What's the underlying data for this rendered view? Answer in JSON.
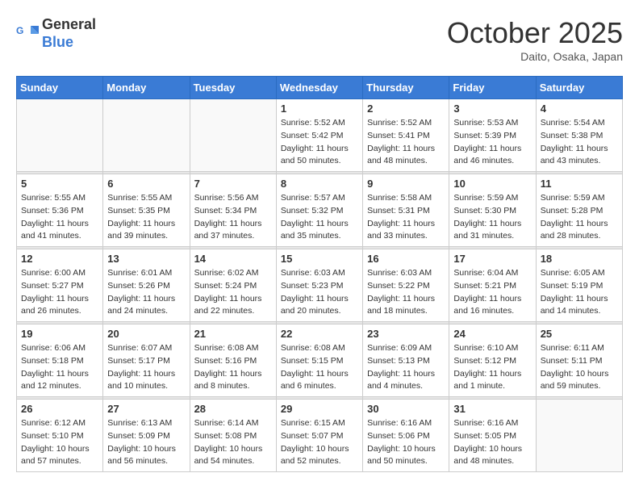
{
  "header": {
    "logo_line1": "General",
    "logo_line2": "Blue",
    "month": "October 2025",
    "location": "Daito, Osaka, Japan"
  },
  "days_of_week": [
    "Sunday",
    "Monday",
    "Tuesday",
    "Wednesday",
    "Thursday",
    "Friday",
    "Saturday"
  ],
  "weeks": [
    [
      {
        "day": "",
        "info": ""
      },
      {
        "day": "",
        "info": ""
      },
      {
        "day": "",
        "info": ""
      },
      {
        "day": "1",
        "info": "Sunrise: 5:52 AM\nSunset: 5:42 PM\nDaylight: 11 hours\nand 50 minutes."
      },
      {
        "day": "2",
        "info": "Sunrise: 5:52 AM\nSunset: 5:41 PM\nDaylight: 11 hours\nand 48 minutes."
      },
      {
        "day": "3",
        "info": "Sunrise: 5:53 AM\nSunset: 5:39 PM\nDaylight: 11 hours\nand 46 minutes."
      },
      {
        "day": "4",
        "info": "Sunrise: 5:54 AM\nSunset: 5:38 PM\nDaylight: 11 hours\nand 43 minutes."
      }
    ],
    [
      {
        "day": "5",
        "info": "Sunrise: 5:55 AM\nSunset: 5:36 PM\nDaylight: 11 hours\nand 41 minutes."
      },
      {
        "day": "6",
        "info": "Sunrise: 5:55 AM\nSunset: 5:35 PM\nDaylight: 11 hours\nand 39 minutes."
      },
      {
        "day": "7",
        "info": "Sunrise: 5:56 AM\nSunset: 5:34 PM\nDaylight: 11 hours\nand 37 minutes."
      },
      {
        "day": "8",
        "info": "Sunrise: 5:57 AM\nSunset: 5:32 PM\nDaylight: 11 hours\nand 35 minutes."
      },
      {
        "day": "9",
        "info": "Sunrise: 5:58 AM\nSunset: 5:31 PM\nDaylight: 11 hours\nand 33 minutes."
      },
      {
        "day": "10",
        "info": "Sunrise: 5:59 AM\nSunset: 5:30 PM\nDaylight: 11 hours\nand 31 minutes."
      },
      {
        "day": "11",
        "info": "Sunrise: 5:59 AM\nSunset: 5:28 PM\nDaylight: 11 hours\nand 28 minutes."
      }
    ],
    [
      {
        "day": "12",
        "info": "Sunrise: 6:00 AM\nSunset: 5:27 PM\nDaylight: 11 hours\nand 26 minutes."
      },
      {
        "day": "13",
        "info": "Sunrise: 6:01 AM\nSunset: 5:26 PM\nDaylight: 11 hours\nand 24 minutes."
      },
      {
        "day": "14",
        "info": "Sunrise: 6:02 AM\nSunset: 5:24 PM\nDaylight: 11 hours\nand 22 minutes."
      },
      {
        "day": "15",
        "info": "Sunrise: 6:03 AM\nSunset: 5:23 PM\nDaylight: 11 hours\nand 20 minutes."
      },
      {
        "day": "16",
        "info": "Sunrise: 6:03 AM\nSunset: 5:22 PM\nDaylight: 11 hours\nand 18 minutes."
      },
      {
        "day": "17",
        "info": "Sunrise: 6:04 AM\nSunset: 5:21 PM\nDaylight: 11 hours\nand 16 minutes."
      },
      {
        "day": "18",
        "info": "Sunrise: 6:05 AM\nSunset: 5:19 PM\nDaylight: 11 hours\nand 14 minutes."
      }
    ],
    [
      {
        "day": "19",
        "info": "Sunrise: 6:06 AM\nSunset: 5:18 PM\nDaylight: 11 hours\nand 12 minutes."
      },
      {
        "day": "20",
        "info": "Sunrise: 6:07 AM\nSunset: 5:17 PM\nDaylight: 11 hours\nand 10 minutes."
      },
      {
        "day": "21",
        "info": "Sunrise: 6:08 AM\nSunset: 5:16 PM\nDaylight: 11 hours\nand 8 minutes."
      },
      {
        "day": "22",
        "info": "Sunrise: 6:08 AM\nSunset: 5:15 PM\nDaylight: 11 hours\nand 6 minutes."
      },
      {
        "day": "23",
        "info": "Sunrise: 6:09 AM\nSunset: 5:13 PM\nDaylight: 11 hours\nand 4 minutes."
      },
      {
        "day": "24",
        "info": "Sunrise: 6:10 AM\nSunset: 5:12 PM\nDaylight: 11 hours\nand 1 minute."
      },
      {
        "day": "25",
        "info": "Sunrise: 6:11 AM\nSunset: 5:11 PM\nDaylight: 10 hours\nand 59 minutes."
      }
    ],
    [
      {
        "day": "26",
        "info": "Sunrise: 6:12 AM\nSunset: 5:10 PM\nDaylight: 10 hours\nand 57 minutes."
      },
      {
        "day": "27",
        "info": "Sunrise: 6:13 AM\nSunset: 5:09 PM\nDaylight: 10 hours\nand 56 minutes."
      },
      {
        "day": "28",
        "info": "Sunrise: 6:14 AM\nSunset: 5:08 PM\nDaylight: 10 hours\nand 54 minutes."
      },
      {
        "day": "29",
        "info": "Sunrise: 6:15 AM\nSunset: 5:07 PM\nDaylight: 10 hours\nand 52 minutes."
      },
      {
        "day": "30",
        "info": "Sunrise: 6:16 AM\nSunset: 5:06 PM\nDaylight: 10 hours\nand 50 minutes."
      },
      {
        "day": "31",
        "info": "Sunrise: 6:16 AM\nSunset: 5:05 PM\nDaylight: 10 hours\nand 48 minutes."
      },
      {
        "day": "",
        "info": ""
      }
    ]
  ]
}
